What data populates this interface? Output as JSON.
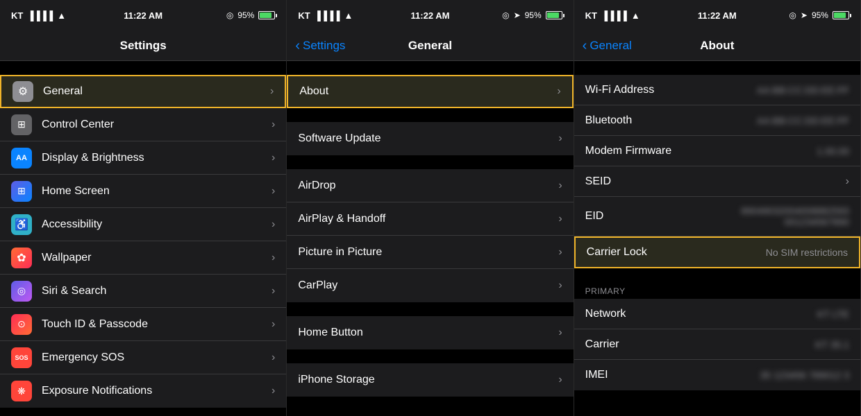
{
  "colors": {
    "accent": "#0a84ff",
    "highlight_border": "#f0b429",
    "text_primary": "#ffffff",
    "text_secondary": "#8e8e93",
    "bg_dark": "#000000",
    "bg_cell": "#1c1c1e",
    "separator": "#3a3a3c"
  },
  "panels": [
    {
      "id": "panel1",
      "status": {
        "carrier": "KT",
        "time": "11:22 AM",
        "battery_pct": "95%"
      },
      "nav": {
        "title": "Settings",
        "back": null
      },
      "items": [
        {
          "icon": "⚙️",
          "icon_bg": "icon-gray",
          "label": "General",
          "value": "",
          "chevron": true,
          "highlighted": true
        },
        {
          "icon": "🎛",
          "icon_bg": "icon-gray2",
          "label": "Control Center",
          "value": "",
          "chevron": true
        },
        {
          "icon": "AA",
          "icon_bg": "icon-blue",
          "label": "Display & Brightness",
          "value": "",
          "chevron": true
        },
        {
          "icon": "⊞",
          "icon_bg": "icon-indigo",
          "label": "Home Screen",
          "value": "",
          "chevron": true
        },
        {
          "icon": "♿",
          "icon_bg": "icon-blue2",
          "label": "Accessibility",
          "value": "",
          "chevron": true
        },
        {
          "icon": "❁",
          "icon_bg": "icon-orange",
          "label": "Wallpaper",
          "value": "",
          "chevron": true
        },
        {
          "icon": "◎",
          "icon_bg": "icon-purple",
          "label": "Siri & Search",
          "value": "",
          "chevron": true
        },
        {
          "icon": "👆",
          "icon_bg": "icon-pink",
          "label": "Touch ID & Passcode",
          "value": "",
          "chevron": true
        },
        {
          "icon": "SOS",
          "icon_bg": "icon-red",
          "label": "Emergency SOS",
          "value": "",
          "chevron": true
        },
        {
          "icon": "⊙",
          "icon_bg": "icon-red",
          "label": "Exposure Notifications",
          "value": "",
          "chevron": true
        }
      ]
    },
    {
      "id": "panel2",
      "status": {
        "carrier": "KT",
        "time": "11:22 AM",
        "battery_pct": "95%"
      },
      "nav": {
        "title": "General",
        "back": "Settings"
      },
      "groups": [
        {
          "items": [
            {
              "label": "About",
              "value": "",
              "chevron": true,
              "highlighted": true
            }
          ]
        },
        {
          "items": [
            {
              "label": "Software Update",
              "value": "",
              "chevron": true
            }
          ]
        },
        {
          "items": [
            {
              "label": "AirDrop",
              "value": "",
              "chevron": true
            },
            {
              "label": "AirPlay & Handoff",
              "value": "",
              "chevron": true
            },
            {
              "label": "Picture in Picture",
              "value": "",
              "chevron": true
            },
            {
              "label": "CarPlay",
              "value": "",
              "chevron": true
            }
          ]
        },
        {
          "items": [
            {
              "label": "Home Button",
              "value": "",
              "chevron": true
            }
          ]
        },
        {
          "items": [
            {
              "label": "iPhone Storage",
              "value": "",
              "chevron": true
            }
          ]
        }
      ]
    },
    {
      "id": "panel3",
      "status": {
        "carrier": "KT",
        "time": "11:22 AM",
        "battery_pct": "95%"
      },
      "nav": {
        "title": "About",
        "back": "General"
      },
      "rows": [
        {
          "label": "Wi-Fi Address",
          "value": "blurred",
          "chevron": false
        },
        {
          "label": "Bluetooth",
          "value": "blurred",
          "chevron": false
        },
        {
          "label": "Modem Firmware",
          "value": "blurred",
          "chevron": false
        },
        {
          "label": "SEID",
          "value": "",
          "chevron": true
        },
        {
          "label": "EID",
          "value": "blurred_long",
          "chevron": false
        },
        {
          "label": "Carrier Lock",
          "value": "No SIM restrictions",
          "chevron": false,
          "highlighted": true
        }
      ],
      "primary_section": {
        "label": "PRIMARY",
        "rows": [
          {
            "label": "Network",
            "value": "blurred",
            "chevron": false
          },
          {
            "label": "Carrier",
            "value": "blurred",
            "chevron": false
          },
          {
            "label": "IMEI",
            "value": "blurred",
            "chevron": false
          }
        ]
      }
    }
  ]
}
